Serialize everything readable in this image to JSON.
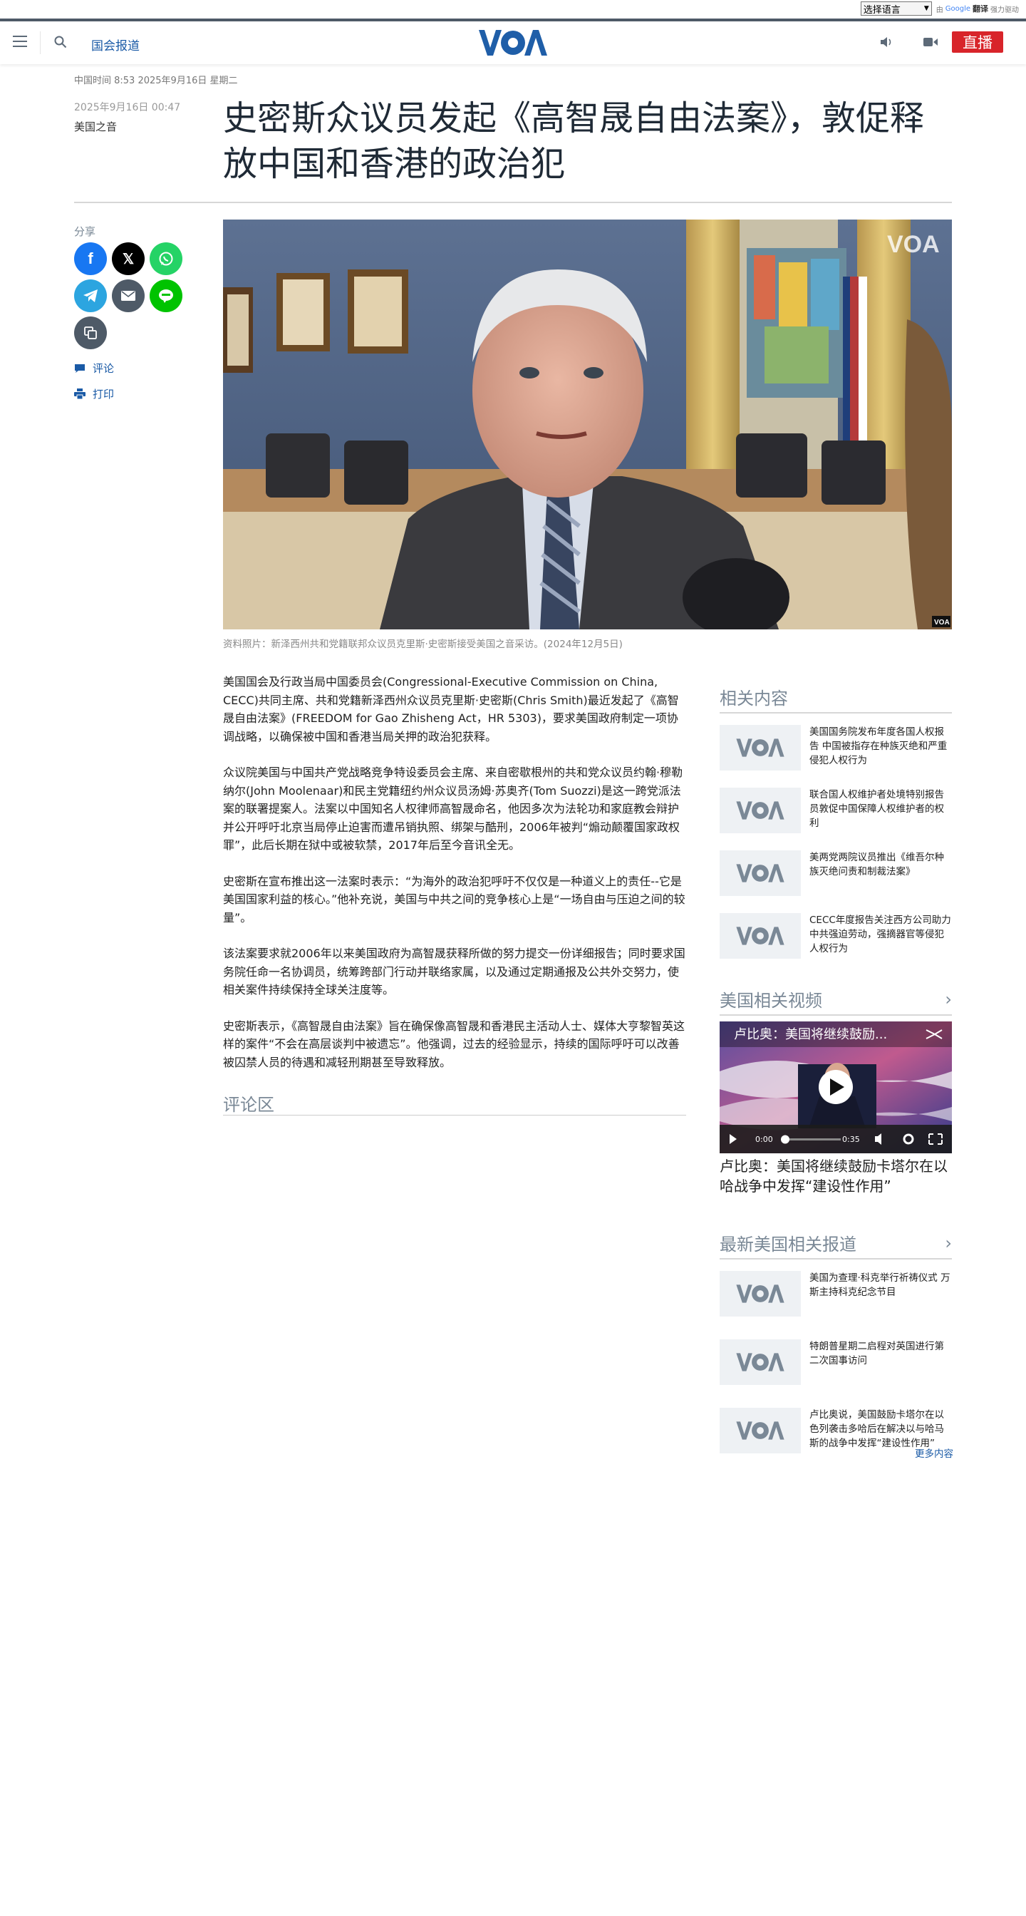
{
  "translate": {
    "select_value": "选择语言",
    "powered_prefix": "由",
    "google": "Google",
    "translate_word": "翻译",
    "powered_suffix": "强力驱动"
  },
  "header": {
    "section_label": "国会报道",
    "logo_text": "VOA",
    "live_label": "直播"
  },
  "article": {
    "meta_time": "中国时间 8:53 2025年9月16日 星期二",
    "pub_date": "2025年9月16日 00:47",
    "author": "美国之音",
    "headline": "史密斯众议员发起《高智晟自由法案》，敦促释放中国和香港的政治犯",
    "caption": "资料照片：新泽西州共和党籍联邦众议员克里斯·史密斯接受美国之音采访。(2024年12月5日)",
    "paragraphs": [
      "美国国会及行政当局中国委员会(Congressional-Executive Commission on China, CECC)共同主席、共和党籍新泽西州众议员克里斯·史密斯(Chris Smith)最近发起了《高智晟自由法案》(FREEDOM for Gao Zhisheng Act，HR 5303)，要求美国政府制定一项协调战略，以确保被中国和香港当局关押的政治犯获释。",
      "众议院美国与中国共产党战略竞争特设委员会主席、来自密歇根州的共和党众议员约翰·穆勒纳尔(John Moolenaar)和民主党籍纽约州众议员汤姆·苏奥齐(Tom Suozzi)是这一跨党派法案的联署提案人。法案以中国知名人权律师高智晟命名，他因多次为法轮功和家庭教会辩护并公开呼吁北京当局停止迫害而遭吊销执照、绑架与酷刑，2006年被判“煽动颠覆国家政权罪”，此后长期在狱中或被软禁，2017年后至今音讯全无。",
      "史密斯在宣布推出这一法案时表示：“为海外的政治犯呼吁不仅仅是一种道义上的责任--它是美国国家利益的核心。”他补充说，美国与中共之间的竞争核心上是“一场自由与压迫之间的较量”。",
      "该法案要求就2006年以来美国政府为高智晟获释所做的努力提交一份详细报告；同时要求国务院任命一名协调员，统筹跨部门行动并联络家属，以及通过定期通报及公共外交努力，使相关案件持续保持全球关注度等。",
      "史密斯表示，《高智晟自由法案》旨在确保像高智晟和香港民主活动人士、媒体大亨黎智英这样的案件“不会在高层谈判中被遗忘”。他强调，过去的经验显示，持续的国际呼吁可以改善被囚禁人员的待遇和减轻刑期甚至导致释放。"
    ],
    "comment_heading": "评论区"
  },
  "share": {
    "label": "分享",
    "comments_label": "评论",
    "print_label": "打印"
  },
  "related": {
    "heading": "相关内容",
    "items": [
      {
        "title": "美国国务院发布年度各国人权报告 中国被指存在种族灭绝和严重侵犯人权行为"
      },
      {
        "title": "联合国人权维护者处境特别报告员敦促中国保障人权维护者的权利"
      },
      {
        "title": "美两党两院议员推出《维吾尔种族灭绝问责和制裁法案》"
      },
      {
        "title": "CECC年度报告关注西方公司助力中共强迫劳动，强摘器官等侵犯人权行为"
      }
    ]
  },
  "videos": {
    "heading": "美国相关视频",
    "overlay_title": "卢比奥：美国将继续鼓励...",
    "time_current": "0:00",
    "time_total": "0:35",
    "title": "卢比奥：美国将继续鼓励卡塔尔在以哈战争中发挥“建设性作用”",
    "progress": 0.0
  },
  "latest": {
    "heading": "最新美国相关报道",
    "items": [
      {
        "title": "美国为查理·科克举行祈祷仪式 万斯主持科克纪念节目"
      },
      {
        "title": "特朗普星期二启程对英国进行第二次国事访问"
      },
      {
        "title": "卢比奥说，美国鼓励卡塔尔在以色列袭击多哈后在解决以与哈马斯的战争中发挥“建设性作用”"
      }
    ],
    "more_label": "更多内容"
  },
  "photo": {
    "watermark": "VOA",
    "badge": "VOA"
  },
  "colors": {
    "accent": "#1a5aa6",
    "live": "#d8242a",
    "header_border": "#4e5a67",
    "logo_blue": "#1f5ea8"
  }
}
